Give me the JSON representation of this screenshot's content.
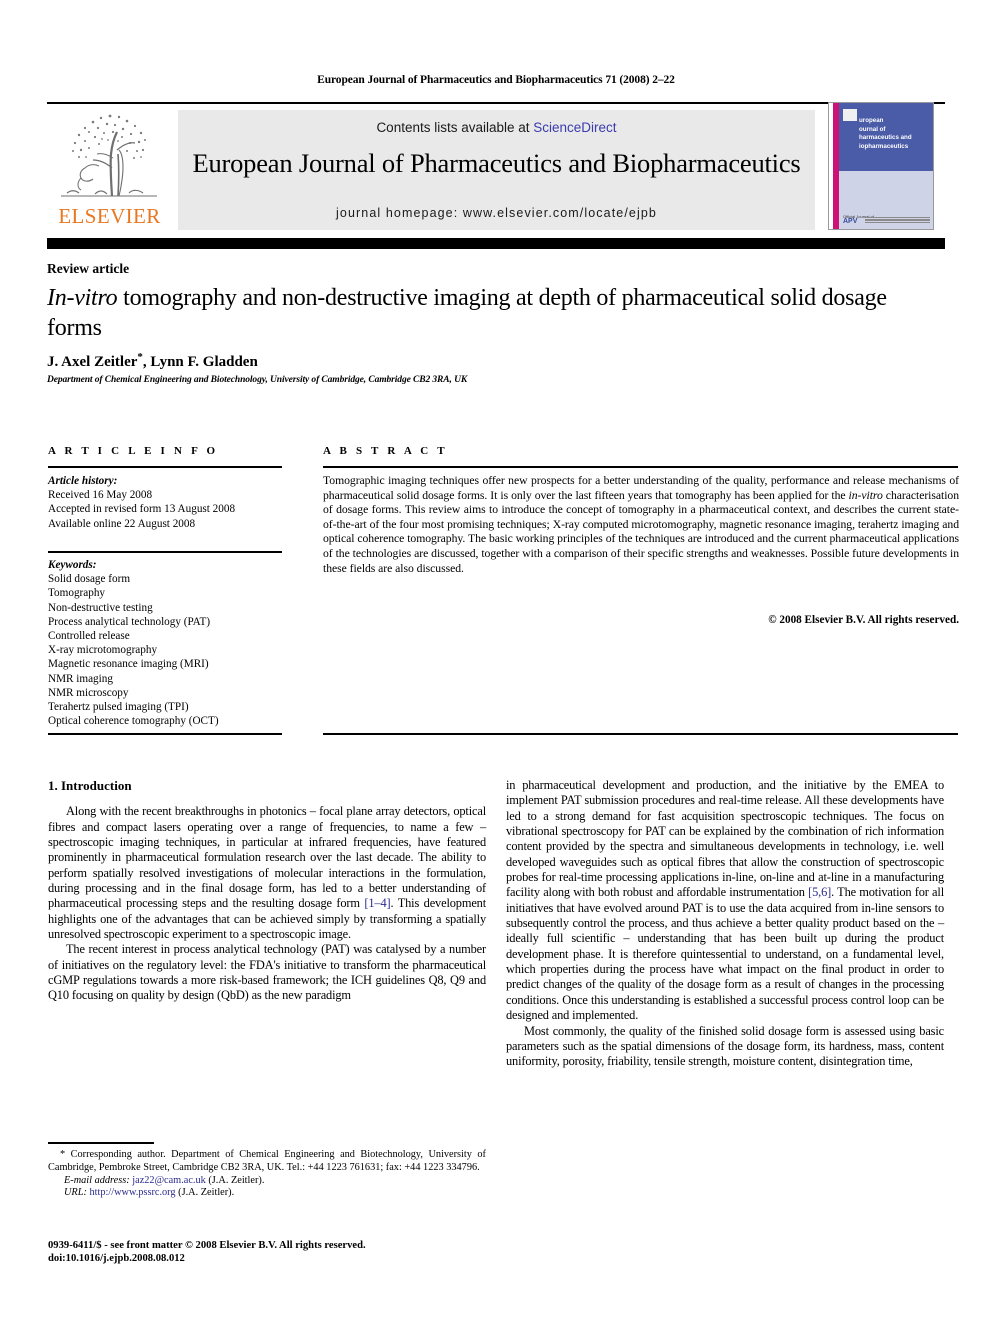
{
  "running_head": "European Journal of Pharmaceutics and Biopharmaceutics 71 (2008) 2–22",
  "masthead": {
    "contents_prefix": "Contents lists available at ",
    "sciencedirect": "ScienceDirect",
    "journal_title": "European Journal of Pharmaceutics and Biopharmaceutics",
    "homepage": "journal homepage: www.elsevier.com/locate/ejpb",
    "publisher_logo_text": "ELSEVIER",
    "accent_orange": "#E87722",
    "link_blue": "#3b3bb0"
  },
  "cover": {
    "line1": "uropean",
    "line2": "ournal of",
    "line3": "harmaceutics and",
    "line4": "iopharmaceutics",
    "footer_label": "Official Journal of",
    "footer_org": "APV",
    "band_blue": "#4a5ba8",
    "stripe_magenta": "#cc1177"
  },
  "article": {
    "kicker": "Review article",
    "title_italic": "In-vitro",
    "title_rest": " tomography and non-destructive imaging at depth of pharmaceutical solid dosage forms",
    "authors": "J. Axel Zeitler",
    "authors_mark": "*",
    "authors_second": ", Lynn F. Gladden",
    "affiliation": "Department of Chemical Engineering and Biotechnology, University of Cambridge, Cambridge CB2 3RA, UK"
  },
  "info": {
    "heading": "A R T I C L E   I N F O",
    "history_label": "Article history:",
    "history": [
      "Received 16 May 2008",
      "Accepted in revised form 13 August 2008",
      "Available online 22 August 2008"
    ],
    "keywords_label": "Keywords:",
    "keywords": [
      "Solid dosage form",
      "Tomography",
      "Non-destructive testing",
      "Process analytical technology (PAT)",
      "Controlled release",
      "X-ray microtomography",
      "Magnetic resonance imaging (MRI)",
      "NMR imaging",
      "NMR microscopy",
      "Terahertz pulsed imaging (TPI)",
      "Optical coherence tomography (OCT)"
    ]
  },
  "abstract": {
    "heading": "A B S T R A C T",
    "part1": "Tomographic imaging techniques offer new prospects for a better understanding of the quality, performance and release mechanisms of pharmaceutical solid dosage forms. It is only over the last fifteen years that tomography has been applied for the ",
    "italic1": "in-vitro",
    "part2": " characterisation of dosage forms. This review aims to introduce the concept of tomography in a pharmaceutical context, and describes the current state-of-the-art of the four most promising techniques; X-ray computed microtomography, magnetic resonance imaging, terahertz imaging and optical coherence tomography. The basic working principles of the techniques are introduced and the current pharmaceutical applications of the technologies are discussed, together with a comparison of their specific strengths and weaknesses. Possible future developments in these fields are also discussed.",
    "copyright": "© 2008 Elsevier B.V. All rights reserved."
  },
  "body": {
    "section_heading": "1. Introduction",
    "left_p1_a": "Along with the recent breakthroughs in photonics – focal plane array detectors, optical fibres and compact lasers operating over a range of frequencies, to name a few – spectroscopic imaging techniques, in particular at infrared frequencies, have featured prominently in pharmaceutical formulation research over the last decade. The ability to perform spatially resolved investigations of molecular interactions in the formulation, during processing and in the final dosage form, has led to a better understanding of pharmaceutical processing steps and the resulting dosage form ",
    "left_p1_ref": "[1–4]",
    "left_p1_b": ". This development highlights one of the advantages that can be achieved simply by transforming a spatially unresolved spectroscopic experiment to a spectroscopic image.",
    "left_p2": "The recent interest in process analytical technology (PAT) was catalysed by a number of initiatives on the regulatory level: the FDA's initiative to transform the pharmaceutical cGMP regulations towards a more risk-based framework; the ICH guidelines Q8, Q9 and Q10 focusing on quality by design (QbD) as the new paradigm",
    "right_p1_a": "in pharmaceutical development and production, and the initiative by the EMEA to implement PAT submission procedures and real-time release. All these developments have led to a strong demand for fast acquisition spectroscopic techniques. The focus on vibrational spectroscopy for PAT can be explained by the combination of rich information content provided by the spectra and simultaneous developments in technology, i.e. well developed waveguides such as optical fibres that allow the construction of spectroscopic probes for real-time processing applications in-line, on-line and at-line in a manufacturing facility along with both robust and affordable instrumentation ",
    "right_p1_ref": "[5,6]",
    "right_p1_b": ". The motivation for all initiatives that have evolved around PAT is to use the data acquired from in-line sensors to subsequently control the process, and thus achieve a better quality product based on the – ideally full scientific – understanding that has been built up during the product development phase. It is therefore quintessential to understand, on a fundamental level, which properties during the process have what impact on the final product in order to predict changes of the quality of the dosage form as a result of changes in the processing conditions. Once this understanding is established a successful process control loop can be designed and implemented.",
    "right_p2": "Most commonly, the quality of the finished solid dosage form is assessed using basic parameters such as the spatial dimensions of the dosage form, its hardness, mass, content uniformity, porosity, friability, tensile strength, moisture content, disintegration time,"
  },
  "footnote": {
    "corresponding": "* Corresponding author. Department of Chemical Engineering and Biotechnology, University of Cambridge, Pembroke Street, Cambridge CB2 3RA, UK. Tel.: +44 1223 761631; fax: +44 1223 334796.",
    "email_label": "E-mail address:",
    "email": "jaz22@cam.ac.uk",
    "email_attrib": " (J.A. Zeitler).",
    "url_label": "URL:",
    "url": "http://www.pssrc.org",
    "url_attrib": " (J.A. Zeitler)."
  },
  "imprint": {
    "line1": "0939-6411/$ - see front matter © 2008 Elsevier B.V. All rights reserved.",
    "line2": "doi:10.1016/j.ejpb.2008.08.012"
  }
}
